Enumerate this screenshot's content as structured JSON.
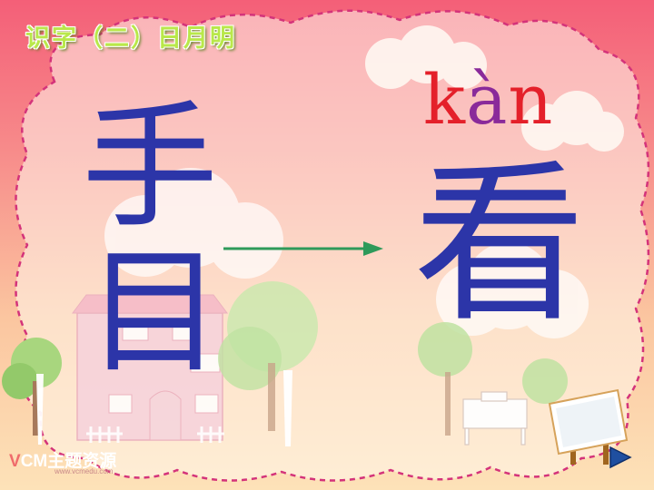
{
  "title": {
    "chars": [
      "识",
      "字",
      "（",
      "二",
      "）",
      "日",
      "月",
      "明"
    ]
  },
  "pinyin": {
    "part1": "k",
    "part2": "à",
    "part3": "n"
  },
  "characters": {
    "left_top": "手",
    "left_bottom": "目",
    "result": "看"
  },
  "logo": {
    "brand_prefix": "V",
    "brand_rest": "CM主题资源",
    "url": "www.vcmedu.com"
  },
  "colors": {
    "character": "#2c35a8",
    "pinyin_consonant": "#e4202a",
    "pinyin_vowel": "#8a2a9a",
    "arrow": "#2e9a5a",
    "frame_dash": "#d4337a"
  },
  "icons": {
    "arrow": "arrow-right-icon",
    "next": "play-triangle-icon"
  }
}
